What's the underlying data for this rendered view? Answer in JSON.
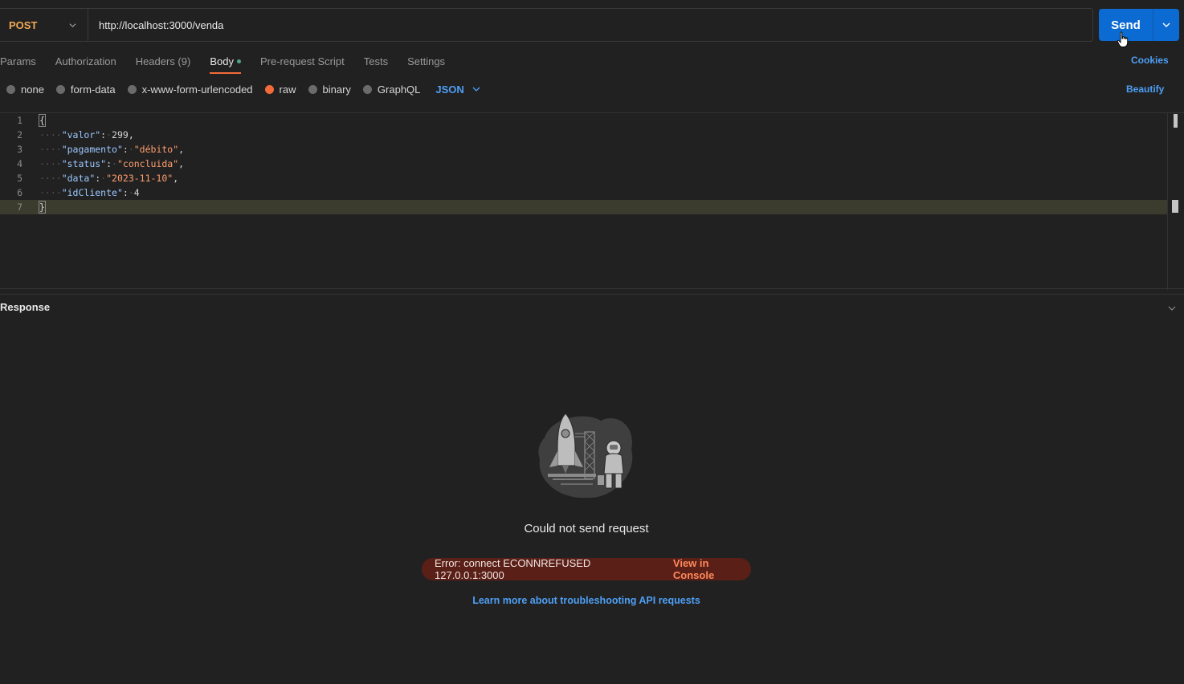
{
  "request": {
    "method": "POST",
    "url": "http://localhost:3000/venda",
    "send_label": "Send"
  },
  "tabs": [
    {
      "label": "Params",
      "active": false
    },
    {
      "label": "Authorization",
      "active": false
    },
    {
      "label": "Headers (9)",
      "active": false
    },
    {
      "label": "Body",
      "active": true
    },
    {
      "label": "Pre-request Script",
      "active": false
    },
    {
      "label": "Tests",
      "active": false
    },
    {
      "label": "Settings",
      "active": false
    }
  ],
  "cookies_label": "Cookies",
  "body_options": [
    {
      "label": "none",
      "selected": false
    },
    {
      "label": "form-data",
      "selected": false
    },
    {
      "label": "x-www-form-urlencoded",
      "selected": false
    },
    {
      "label": "raw",
      "selected": true
    },
    {
      "label": "binary",
      "selected": false
    },
    {
      "label": "GraphQL",
      "selected": false
    }
  ],
  "body_format": "JSON",
  "beautify_label": "Beautify",
  "editor": {
    "line_numbers": [
      "1",
      "2",
      "3",
      "4",
      "5",
      "6",
      "7"
    ],
    "open_brace": "{",
    "close_brace": "}",
    "fields": [
      {
        "key": "\"valor\"",
        "value": "299",
        "type": "number",
        "comma": ","
      },
      {
        "key": "\"pagamento\"",
        "value": "\"débito\"",
        "type": "string",
        "comma": ","
      },
      {
        "key": "\"status\"",
        "value": "\"concluida\"",
        "type": "string",
        "comma": ","
      },
      {
        "key": "\"data\"",
        "value": "\"2023-11-10\"",
        "type": "string",
        "comma": ","
      },
      {
        "key": "\"idCliente\"",
        "value": "4",
        "type": "number",
        "comma": ""
      }
    ],
    "current_line": 7
  },
  "response": {
    "title": "Response",
    "error_title": "Could not send request",
    "error_message": "Error: connect ECONNREFUSED 127.0.0.1:3000",
    "console_link": "View in Console",
    "learn_link": "Learn more about troubleshooting API requests"
  },
  "colors": {
    "background": "#212121",
    "accent_orange": "#f26b3a",
    "link_blue": "#4e9ff5",
    "send_blue": "#0b6bd3",
    "method_post": "#f0a956",
    "error_pill": "#5a1f16"
  }
}
